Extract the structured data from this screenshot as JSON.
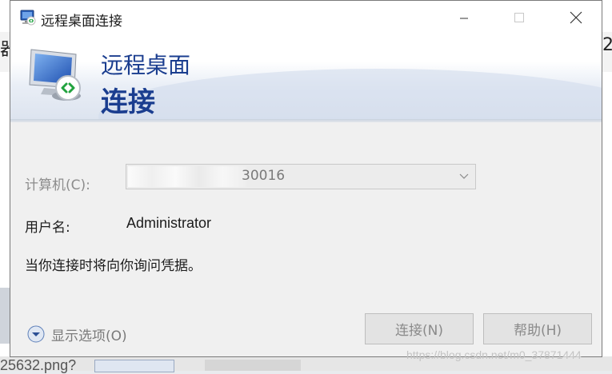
{
  "background": {
    "left_partial_char": "器",
    "right_partial_char": "2",
    "bottom_partial_text": "25632.png?"
  },
  "window": {
    "title": "远程桌面连接",
    "controls": {
      "minimize_icon": "minimize-icon",
      "maximize_icon": "maximize-icon",
      "close_icon": "close-icon"
    }
  },
  "banner": {
    "line1": "远程桌面",
    "line2": "连接"
  },
  "form": {
    "computer_label": "计算机(C):",
    "computer_value": "30016",
    "username_label": "用户名:",
    "username_value": "Administrator",
    "info": "当你连接时将向你询问凭据。"
  },
  "footer": {
    "show_options": "显示选项(O)",
    "connect_button": "连接(N)",
    "help_button": "帮助(H)"
  },
  "watermark": "https://blog.csdn.net/m0_37871444",
  "colors": {
    "banner_text": "#1a3d8f",
    "dialog_bg": "#f0f0f0",
    "disabled_text": "#8a8a8a"
  }
}
